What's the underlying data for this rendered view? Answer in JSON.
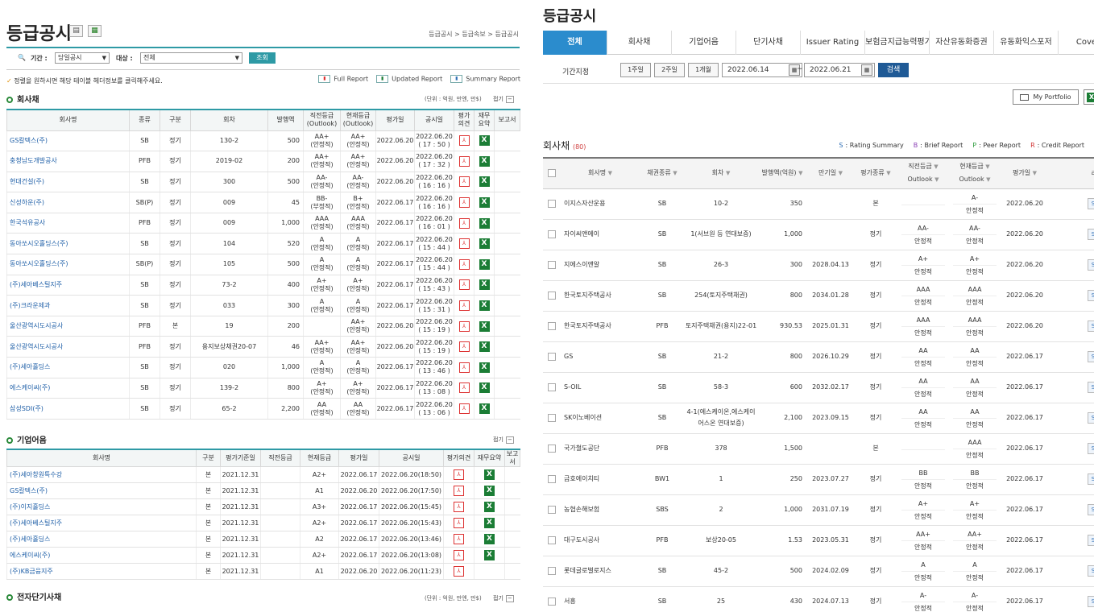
{
  "left": {
    "title": "등급공시",
    "breadcrumb": "등급공시 > 등급속보 > 등급공시",
    "filter": {
      "period_label": "기간 :",
      "period_value": "당일공시",
      "target_label": "대상 :",
      "target_value": "전체",
      "search_label": "조회"
    },
    "note": "정렬을 원하시면 해당 테이블 헤더정보를 클릭해주세요.",
    "reports": [
      "Full Report",
      "Updated Report",
      "Summary Report"
    ],
    "bonds": {
      "title": "회사채",
      "unit": "(단위 : 억원, 만엔, 만$)",
      "fold": "접기",
      "headers": [
        "회사명",
        "종류",
        "구분",
        "회차",
        "발행액",
        "직전등급\n(Outlook)",
        "현재등급\n(Outlook)",
        "평가일",
        "공시일",
        "평가\n의견",
        "재무\n요약",
        "보고서"
      ],
      "rows": [
        [
          "GS칼텍스(주)",
          "SB",
          "정기",
          "130-2",
          "500",
          "AA+\n(안정적)",
          "AA+\n(안정적)",
          "2022.06.20",
          "2022.06.20\n( 17 : 50 )"
        ],
        [
          "충청남도개발공사",
          "PFB",
          "정기",
          "2019-02",
          "200",
          "AA+\n(안정적)",
          "AA+\n(안정적)",
          "2022.06.20",
          "2022.06.20\n( 17 : 32 )"
        ],
        [
          "현대건설(주)",
          "SB",
          "정기",
          "300",
          "500",
          "AA-\n(안정적)",
          "AA-\n(안정적)",
          "2022.06.20",
          "2022.06.20\n( 16 : 16 )"
        ],
        [
          "신성하운(주)",
          "SB(P)",
          "정기",
          "009",
          "45",
          "BB-\n(부정적)",
          "B+\n(안정적)",
          "2022.06.17",
          "2022.06.20\n( 16 : 16 )"
        ],
        [
          "한국석유공사",
          "PFB",
          "정기",
          "009",
          "1,000",
          "AAA\n(안정적)",
          "AAA\n(안정적)",
          "2022.06.17",
          "2022.06.20\n( 16 : 01 )"
        ],
        [
          "동아쏘시오홀딩스(주)",
          "SB",
          "정기",
          "104",
          "520",
          "A\n(안정적)",
          "A\n(안정적)",
          "2022.06.17",
          "2022.06.20\n( 15 : 44 )"
        ],
        [
          "동아쏘시오홀딩스(주)",
          "SB(P)",
          "정기",
          "105",
          "500",
          "A\n(안정적)",
          "A\n(안정적)",
          "2022.06.17",
          "2022.06.20\n( 15 : 44 )"
        ],
        [
          "(주)세아베스틸지주",
          "SB",
          "정기",
          "73-2",
          "400",
          "A+\n(안정적)",
          "A+\n(안정적)",
          "2022.06.17",
          "2022.06.20\n( 15 : 43 )"
        ],
        [
          "(주)크라운제과",
          "SB",
          "정기",
          "033",
          "300",
          "A\n(안정적)",
          "A\n(안정적)",
          "2022.06.17",
          "2022.06.20\n( 15 : 31 )"
        ],
        [
          "울산광역시도시공사",
          "PFB",
          "본",
          "19",
          "200",
          "",
          "AA+\n(안정적)",
          "2022.06.20",
          "2022.06.20\n( 15 : 19 )"
        ],
        [
          "울산광역시도시공사",
          "PFB",
          "정기",
          "용지보상채권20-07",
          "46",
          "AA+\n(안정적)",
          "AA+\n(안정적)",
          "2022.06.20",
          "2022.06.20\n( 15 : 19 )"
        ],
        [
          "(주)세아홀딩스",
          "SB",
          "정기",
          "020",
          "1,000",
          "A\n(안정적)",
          "A\n(안정적)",
          "2022.06.17",
          "2022.06.20\n( 13 : 46 )"
        ],
        [
          "에스케이씨(주)",
          "SB",
          "정기",
          "139-2",
          "800",
          "A+\n(안정적)",
          "A+\n(안정적)",
          "2022.06.17",
          "2022.06.20\n( 13 : 08 )"
        ],
        [
          "삼성SDI(주)",
          "SB",
          "정기",
          "65-2",
          "2,200",
          "AA\n(안정적)",
          "AA\n(안정적)",
          "2022.06.17",
          "2022.06.20\n( 13 : 06 )"
        ]
      ]
    },
    "cp": {
      "title": "기업어음",
      "fold": "접기",
      "headers": [
        "회사명",
        "구분",
        "평가기준일",
        "직전등급",
        "현재등급",
        "평가일",
        "공시일",
        "평가의견",
        "재무요약",
        "보고서"
      ],
      "rows": [
        [
          "(주)세아창원특수강",
          "본",
          "2021.12.31",
          "",
          "A2+",
          "2022.06.17",
          "2022.06.20(18:50)"
        ],
        [
          "GS칼텍스(주)",
          "본",
          "2021.12.31",
          "",
          "A1",
          "2022.06.20",
          "2022.06.20(17:50)"
        ],
        [
          "(주)이지홀딩스",
          "본",
          "2021.12.31",
          "",
          "A3+",
          "2022.06.17",
          "2022.06.20(15:45)"
        ],
        [
          "(주)세아베스틸지주",
          "본",
          "2021.12.31",
          "",
          "A2+",
          "2022.06.17",
          "2022.06.20(15:43)"
        ],
        [
          "(주)세아홀딩스",
          "본",
          "2021.12.31",
          "",
          "A2",
          "2022.06.17",
          "2022.06.20(13:46)"
        ],
        [
          "에스케이씨(주)",
          "본",
          "2021.12.31",
          "",
          "A2+",
          "2022.06.17",
          "2022.06.20(13:08)"
        ],
        [
          "(주)KB금융지주",
          "본",
          "2021.12.31",
          "",
          "A1",
          "2022.06.20",
          "2022.06.20(11:23)"
        ]
      ]
    },
    "estb": {
      "title": "전자단기사채",
      "unit": "(단위 : 억원, 만엔, 만$)",
      "fold": "접기"
    }
  },
  "right": {
    "title": "등급공시",
    "tabs": [
      "전체",
      "회사채",
      "기업어음",
      "단기사채",
      "Issuer Rating",
      "보험금지급능력평가",
      "자산유동화증권",
      "유동화익스포저",
      "Covere"
    ],
    "filter": {
      "label": "기간지정",
      "buttons": [
        "1주일",
        "2주일",
        "1개월"
      ],
      "date_from": "2022.06.14",
      "tilde": "~",
      "date_to": "2022.06.21",
      "search": "검색"
    },
    "portfolio": "My Portfolio",
    "section": "회사채",
    "count": "(80)",
    "legend": [
      {
        "k": "S",
        "t": ": Rating Summary",
        "c": "#2f6fb5"
      },
      {
        "k": "B",
        "t": ": Brief Report",
        "c": "#8a3fb5"
      },
      {
        "k": "P",
        "t": ": Peer Report",
        "c": "#2a9a3a"
      },
      {
        "k": "R",
        "t": ": Credit Report",
        "c": "#d03030"
      }
    ],
    "headers": {
      "company": "회사명",
      "type": "채권종류",
      "round": "회차",
      "amount": "발행액(억원)",
      "maturity": "만기일",
      "eval_type": "평가종류",
      "prev1": "직전등급",
      "prev2": "Outlook",
      "cur1": "현재등급",
      "cur2": "Outlook",
      "date": "평가일",
      "rep": "리"
    },
    "rows": [
      [
        "이지스자산운용",
        "SB",
        "10-2",
        "350",
        "",
        "본",
        "",
        "",
        "A-",
        "안정적",
        "2022.06.20"
      ],
      [
        "자이씨앤에이",
        "SB",
        "1(서브원 등 연대보증)",
        "1,000",
        "",
        "정기",
        "AA-",
        "안정적",
        "AA-",
        "안정적",
        "2022.06.20"
      ],
      [
        "지에스이앤알",
        "SB",
        "26-3",
        "300",
        "2028.04.13",
        "정기",
        "A+",
        "안정적",
        "A+",
        "안정적",
        "2022.06.20"
      ],
      [
        "한국토지주택공사",
        "SB",
        "254(토지주택채권)",
        "800",
        "2034.01.28",
        "정기",
        "AAA",
        "안정적",
        "AAA",
        "안정적",
        "2022.06.20"
      ],
      [
        "한국토지주택공사",
        "PFB",
        "토지주택채권(용지)22-01",
        "930.53",
        "2025.01.31",
        "정기",
        "AAA",
        "안정적",
        "AAA",
        "안정적",
        "2022.06.20"
      ],
      [
        "GS",
        "SB",
        "21-2",
        "800",
        "2026.10.29",
        "정기",
        "AA",
        "안정적",
        "AA",
        "안정적",
        "2022.06.17"
      ],
      [
        "S-OIL",
        "SB",
        "58-3",
        "600",
        "2032.02.17",
        "정기",
        "AA",
        "안정적",
        "AA",
        "안정적",
        "2022.06.17"
      ],
      [
        "SK이노베이션",
        "SB",
        "4-1(에스케이온,에스케이어스온 연대보증)",
        "2,100",
        "2023.09.15",
        "정기",
        "AA",
        "안정적",
        "AA",
        "안정적",
        "2022.06.17"
      ],
      [
        "국가철도공단",
        "PFB",
        "378",
        "1,500",
        "",
        "본",
        "",
        "",
        "AAA",
        "안정적",
        "2022.06.17"
      ],
      [
        "금호에이치티",
        "BW1",
        "1",
        "250",
        "2023.07.27",
        "정기",
        "BB",
        "안정적",
        "BB",
        "안정적",
        "2022.06.17"
      ],
      [
        "농협손해보험",
        "SBS",
        "2",
        "1,000",
        "2031.07.19",
        "정기",
        "A+",
        "안정적",
        "A+",
        "안정적",
        "2022.06.17"
      ],
      [
        "대구도시공사",
        "PFB",
        "보상20-05",
        "1.53",
        "2023.05.31",
        "정기",
        "AA+",
        "안정적",
        "AA+",
        "안정적",
        "2022.06.17"
      ],
      [
        "롯데글로벌로지스",
        "SB",
        "45-2",
        "500",
        "2024.02.09",
        "정기",
        "A",
        "안정적",
        "A",
        "안정적",
        "2022.06.17"
      ],
      [
        "서흥",
        "SB",
        "25",
        "430",
        "2024.07.13",
        "정기",
        "A-",
        "안정적",
        "A-",
        "안정적",
        "2022.06.17"
      ]
    ],
    "s_label": "S"
  },
  "icons": {
    "print": "print-icon",
    "excel": "excel-icon",
    "search": "search-icon",
    "calendar": "calendar-icon",
    "pdf": "pdf-icon"
  }
}
